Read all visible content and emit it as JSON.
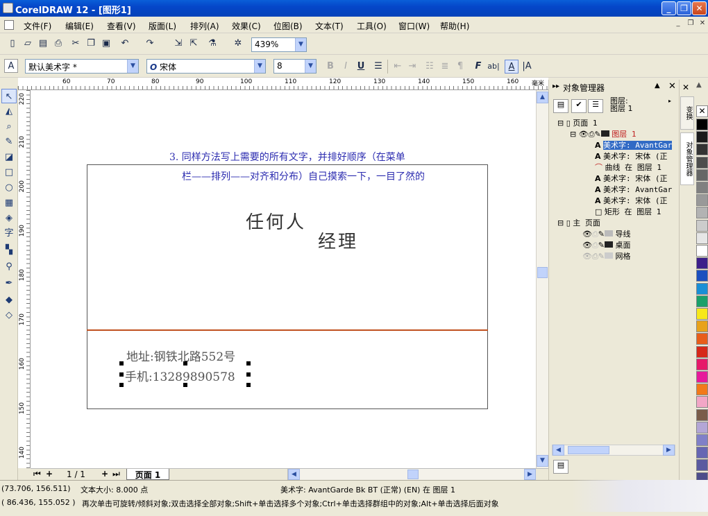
{
  "window": {
    "title": "CorelDRAW 12 - [图形1]",
    "buttons": [
      "_",
      "❐",
      "✕"
    ]
  },
  "menu": [
    "文件(F)",
    "编辑(E)",
    "查看(V)",
    "版面(L)",
    "排列(A)",
    "效果(C)",
    "位图(B)",
    "文本(T)",
    "工具(O)",
    "窗口(W)",
    "帮助(H)"
  ],
  "mdi_buttons": [
    "_",
    "❐",
    "✕"
  ],
  "standard_toolbar": {
    "buttons": [
      "new-icon",
      "open-icon",
      "save-icon",
      "print-icon",
      "cut-icon",
      "copy-icon",
      "paste-icon",
      "undo-icon",
      "redo-icon",
      "import-icon",
      "export-icon",
      "launch-icon",
      "corel-online-icon"
    ],
    "zoom": "439%"
  },
  "property_bar": {
    "style": "默认美术字 *",
    "font": "宋体",
    "font_size": "8",
    "format_buttons": [
      "B",
      "I",
      "U"
    ]
  },
  "rulers": {
    "units_label": "毫米",
    "h_ticks": [
      "60",
      "70",
      "80",
      "90",
      "100",
      "110",
      "120",
      "130",
      "140",
      "150",
      "160"
    ],
    "v_ticks": [
      "220",
      "210",
      "200",
      "190",
      "180",
      "170",
      "160",
      "150",
      "140"
    ]
  },
  "canvas": {
    "note_line1": "3. 同样方法写上需要的所有文字，并排好顺序（在菜单",
    "note_line2": "栏——排列——对齐和分布）自己摸索一下，一目了然的",
    "name": "任何人",
    "title": "经理",
    "address": "地址:钢铁北路552号",
    "phone": "手机:13289890578"
  },
  "pagebar": {
    "page_count": "1 / 1",
    "page_tab": "页面 1"
  },
  "docker": {
    "title": "对象管理器",
    "layer_label_1": "图层:",
    "layer_label_2": "图层 1",
    "tree": [
      {
        "text": "页面 1",
        "indent": 0
      },
      {
        "text": "图层 1",
        "indent": 1
      },
      {
        "text": "美术字: AvantGar",
        "indent": 2,
        "selected": true
      },
      {
        "text": "美术字: 宋体 (正",
        "indent": 2
      },
      {
        "text": "曲线 在 图层 1",
        "indent": 2
      },
      {
        "text": "美术字: 宋体 (正",
        "indent": 2
      },
      {
        "text": "美术字: AvantGar",
        "indent": 2
      },
      {
        "text": "美术字: 宋体 (正",
        "indent": 2
      },
      {
        "text": "矩形 在 图层 1",
        "indent": 2
      },
      {
        "text": "主 页面",
        "indent": 0
      },
      {
        "text": "导线",
        "indent": 1
      },
      {
        "text": "桌面",
        "indent": 1
      },
      {
        "text": "网格",
        "indent": 1
      }
    ]
  },
  "side_tabs": [
    "变换",
    "对象管理器"
  ],
  "palette": [
    "#ffffff",
    "#000000",
    "#1a1a1a",
    "#333333",
    "#4d4d4d",
    "#666666",
    "#808080",
    "#999999",
    "#b3b3b3",
    "#cccccc",
    "#e6e6e6",
    "#ffffff",
    "#3d1f8a",
    "#1b4fbf",
    "#1a8fd6",
    "#1aa06a",
    "#f7e81a",
    "#e8a21a",
    "#e85d1a",
    "#d6281a",
    "#e61a6a",
    "#e61a9b",
    "#f27a1a",
    "#f2a6c6",
    "#7a5c4a",
    "#b3a6d6",
    "#8080c8",
    "#6666b3",
    "#5a5aa0",
    "#4d4d8a"
  ],
  "status": {
    "coords1": "(73.706, 156.511)",
    "size": "文本大小: 8.000 点",
    "object": "美术字: AvantGarde Bk BT (正常) (EN) 在 图层 1",
    "coords2": "( 86.436, 155.052 )",
    "hint": "再次单击可旋转/倾斜对象;双击选择全部对象;Shift+单击选择多个对象;Ctrl+单击选择群组中的对象;Alt+单击选择后面对象"
  }
}
